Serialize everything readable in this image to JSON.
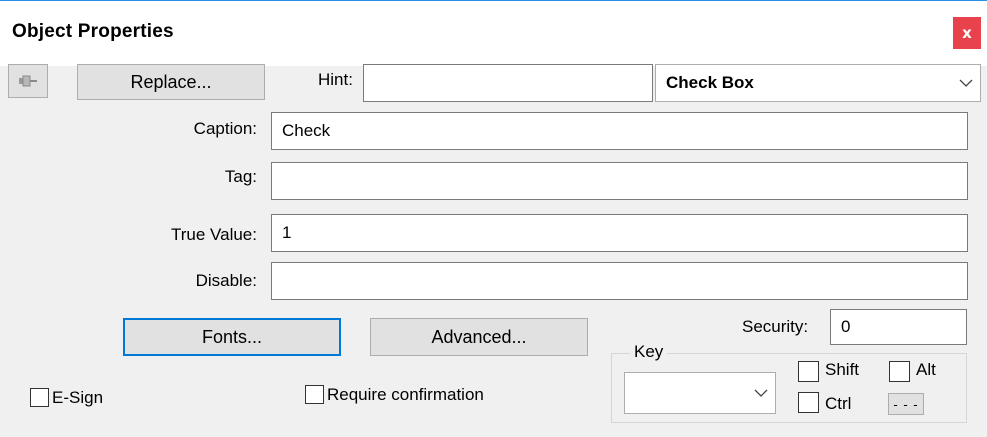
{
  "window": {
    "title": "Object Properties",
    "close_icon": "close-icon",
    "close_label": "x"
  },
  "toolbar": {
    "pin_icon": "pushpin-icon",
    "replace_label": "Replace...",
    "hint_label": "Hint:",
    "hint_value": "",
    "object_type_value": "Check Box"
  },
  "form": {
    "caption_label": "Caption:",
    "caption_value": "Check",
    "tag_label": "Tag:",
    "tag_value": "",
    "true_value_label": "True Value:",
    "true_value_value": "1",
    "disable_label": "Disable:",
    "disable_value": ""
  },
  "buttons": {
    "fonts_label": "Fonts...",
    "advanced_label": "Advanced..."
  },
  "security": {
    "label": "Security:",
    "value": "0"
  },
  "options": {
    "esign_label": "E-Sign",
    "esign_checked": false,
    "require_confirmation_label": "Require confirmation",
    "require_confirmation_checked": false
  },
  "key_group": {
    "legend": "Key",
    "key_value": "",
    "shift_label": "Shift",
    "alt_label": "Alt",
    "ctrl_label": "Ctrl",
    "more_label": "- - -"
  },
  "colors": {
    "close_bg": "#e8434c",
    "focus_border": "#0078d7",
    "dialog_bg": "#f0f0f0"
  }
}
